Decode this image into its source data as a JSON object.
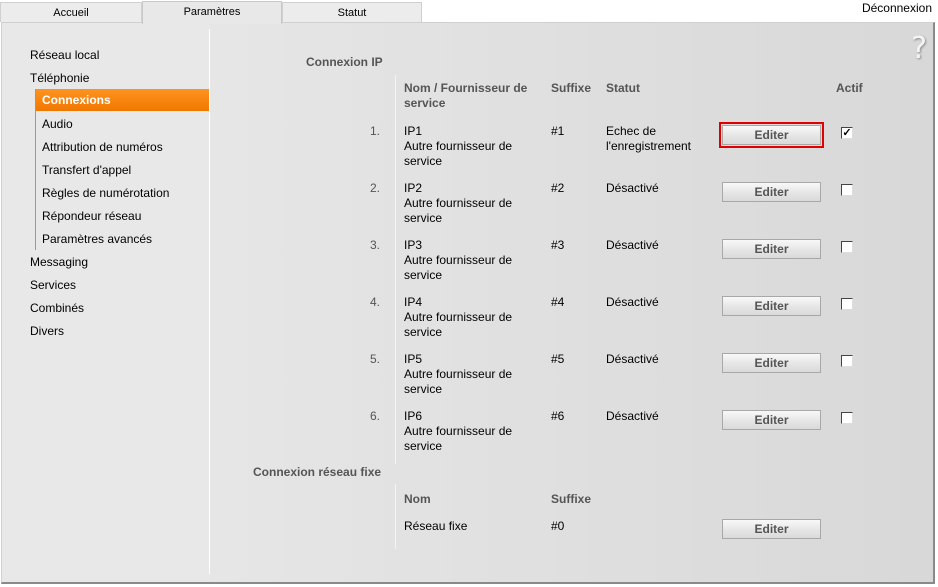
{
  "tabs": [
    {
      "label": "Accueil",
      "active": false
    },
    {
      "label": "Paramètres",
      "active": true
    },
    {
      "label": "Statut",
      "active": false
    }
  ],
  "logout_label": "Déconnexion",
  "help_icon": "?",
  "sidebar": {
    "items": [
      {
        "label": "Réseau local"
      },
      {
        "label": "Téléphonie"
      },
      {
        "label": "Messaging"
      },
      {
        "label": "Services"
      },
      {
        "label": "Combinés"
      },
      {
        "label": "Divers"
      }
    ],
    "telephony_subitems": [
      {
        "label": "Connexions",
        "active": true
      },
      {
        "label": "Audio"
      },
      {
        "label": "Attribution de numéros"
      },
      {
        "label": "Transfert d'appel"
      },
      {
        "label": "Règles de numérotation"
      },
      {
        "label": "Répondeur réseau"
      },
      {
        "label": "Paramètres avancés"
      }
    ]
  },
  "ip_section": {
    "title": "Connexion IP",
    "headers": {
      "name_line1": "Nom / Fournisseur de",
      "name_line2": "service",
      "suffix": "Suffixe",
      "status": "Statut",
      "active": "Actif"
    },
    "rows": [
      {
        "num": "1.",
        "name": "IP1",
        "provider1": "Autre fournisseur de",
        "provider2": "service",
        "suffix": "#1",
        "status1": "Echec de",
        "status2": "l'enregistrement",
        "button": "Editer",
        "active": true
      },
      {
        "num": "2.",
        "name": "IP2",
        "provider1": "Autre fournisseur de",
        "provider2": "service",
        "suffix": "#2",
        "status1": "Désactivé",
        "status2": "",
        "button": "Editer",
        "active": false
      },
      {
        "num": "3.",
        "name": "IP3",
        "provider1": "Autre fournisseur de",
        "provider2": "service",
        "suffix": "#3",
        "status1": "Désactivé",
        "status2": "",
        "button": "Editer",
        "active": false
      },
      {
        "num": "4.",
        "name": "IP4",
        "provider1": "Autre fournisseur de",
        "provider2": "service",
        "suffix": "#4",
        "status1": "Désactivé",
        "status2": "",
        "button": "Editer",
        "active": false
      },
      {
        "num": "5.",
        "name": "IP5",
        "provider1": "Autre fournisseur de",
        "provider2": "service",
        "suffix": "#5",
        "status1": "Désactivé",
        "status2": "",
        "button": "Editer",
        "active": false
      },
      {
        "num": "6.",
        "name": "IP6",
        "provider1": "Autre fournisseur de",
        "provider2": "service",
        "suffix": "#6",
        "status1": "Désactivé",
        "status2": "",
        "button": "Editer",
        "active": false
      }
    ]
  },
  "fixed_section": {
    "title": "Connexion réseau fixe",
    "headers": {
      "name": "Nom",
      "suffix": "Suffixe"
    },
    "row": {
      "name": "Réseau fixe",
      "suffix": "#0",
      "button": "Editer"
    }
  }
}
